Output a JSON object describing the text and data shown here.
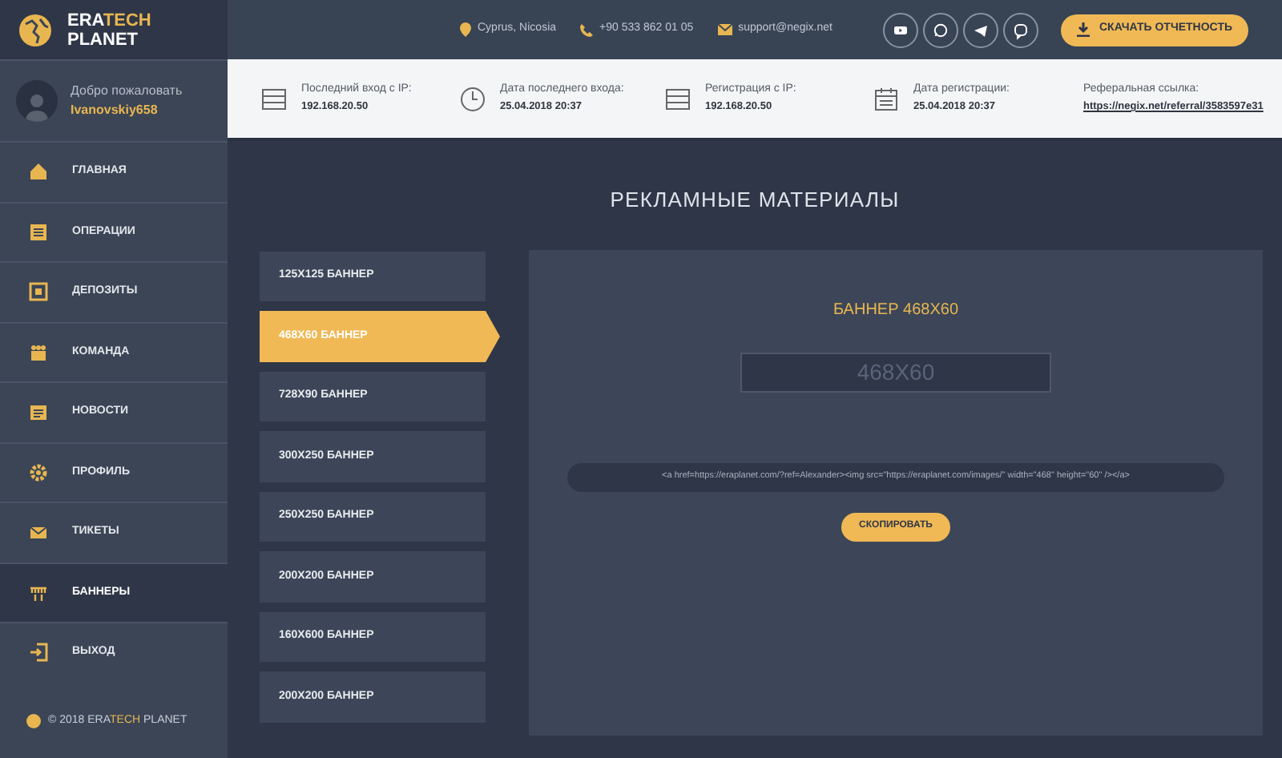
{
  "logo": {
    "part1": "ERA",
    "part2": "TECH",
    "line2": "PLANET"
  },
  "header": {
    "location": "Cyprus, Nicosia",
    "phone": "+90 533 862 01 05",
    "email": "support@negix.net",
    "socials": [
      {
        "kind": "youtube"
      },
      {
        "kind": "whatsapp"
      },
      {
        "kind": "telegram"
      },
      {
        "kind": "viber"
      }
    ],
    "download_button": "СКАЧАТЬ ОТЧЕТНОСТЬ"
  },
  "user": {
    "greeting": "Добро пожаловать",
    "username": "Ivanovskiy658"
  },
  "info_bar": [
    {
      "kind": "server",
      "label": "Последний вход с IP:",
      "value": "192.168.20.50"
    },
    {
      "kind": "clock",
      "label": "Дата последнего входа:",
      "value": "25.04.2018  20:37"
    },
    {
      "kind": "server",
      "label": "Регистрация с IP:",
      "value": "192.168.20.50"
    },
    {
      "kind": "calendar",
      "label": "Дата регистрации:",
      "value": "25.04.2018  20:37"
    },
    {
      "kind": "link",
      "label": "Реферальная ссылка:",
      "value": "https://negix.net/referral/3583597e31"
    }
  ],
  "sidebar": {
    "items": [
      {
        "kind": "home",
        "label": "ГЛАВНАЯ",
        "selected": false
      },
      {
        "kind": "list",
        "label": "ОПЕРАЦИИ",
        "selected": false
      },
      {
        "kind": "box",
        "label": "ДЕПОЗИТЫ",
        "selected": false
      },
      {
        "kind": "team",
        "label": "КОМАНДА",
        "selected": false
      },
      {
        "kind": "news",
        "label": "НОВОСТИ",
        "selected": false
      },
      {
        "kind": "gear",
        "label": "ПРОФИЛЬ",
        "selected": false
      },
      {
        "kind": "mail",
        "label": "ТИКЕТЫ",
        "selected": false
      },
      {
        "kind": "banner",
        "label": "БАННЕРЫ",
        "selected": true
      },
      {
        "kind": "exit",
        "label": "ВЫХОД",
        "selected": false
      }
    ],
    "footer": {
      "prefix": "© 2018 ERA",
      "brand": "TECH",
      "suffix": " PLANET"
    }
  },
  "page_title": "РЕКЛАМНЫЕ МАТЕРИАЛЫ",
  "banner_sizes": [
    {
      "label": "125X125 БАННЕР",
      "selected": false
    },
    {
      "label": "468X60 БАННЕР",
      "selected": true
    },
    {
      "label": "728X90 БАННЕР",
      "selected": false
    },
    {
      "label": "300X250 БАННЕР",
      "selected": false
    },
    {
      "label": "250X250 БАННЕР",
      "selected": false
    },
    {
      "label": "200X200 БАННЕР",
      "selected": false
    },
    {
      "label": "160X600 БАННЕР",
      "selected": false
    },
    {
      "label": "200X200 БАННЕР",
      "selected": false
    }
  ],
  "banner_panel": {
    "title": "БАННЕР 468X60",
    "preview": "468X60",
    "code": "<a href=https://eraplanet.com/?ref=Alexander><img src=\"https://eraplanet.com/images/\" width=\"468\" height=\"60\" /></a>",
    "copy_button": "СКОПИРОВАТЬ"
  }
}
